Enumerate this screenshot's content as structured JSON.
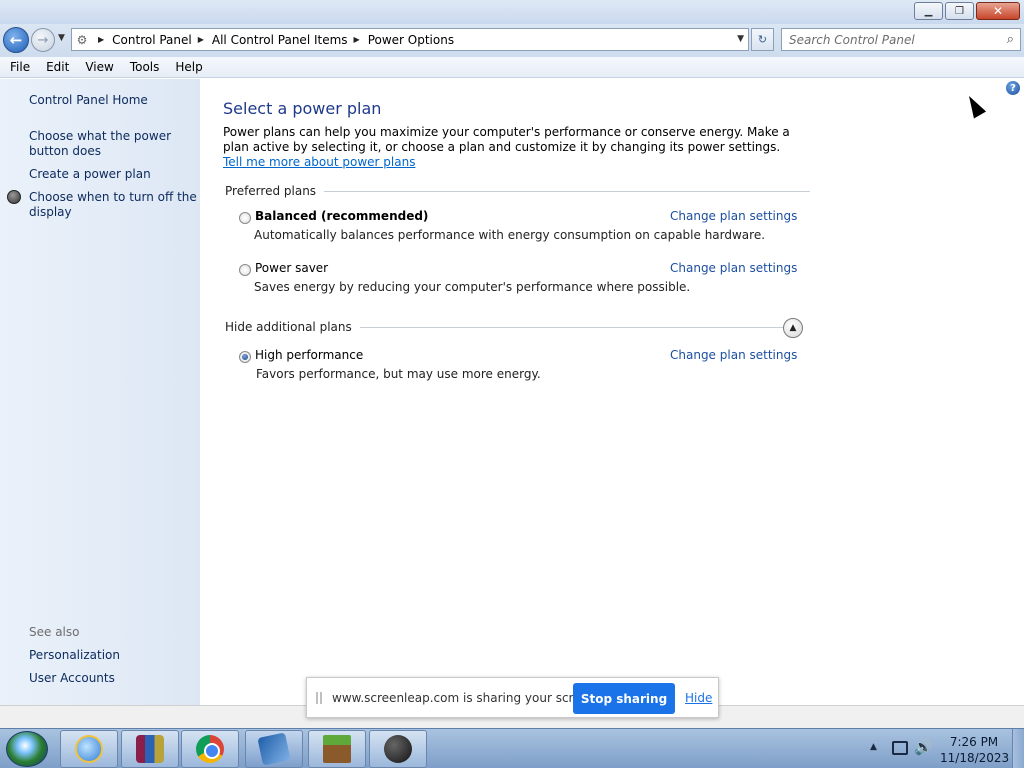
{
  "address": {
    "crumbs": [
      "Control Panel",
      "All Control Panel Items",
      "Power Options"
    ],
    "search_placeholder": "Search Control Panel"
  },
  "menu": [
    "File",
    "Edit",
    "View",
    "Tools",
    "Help"
  ],
  "sidebar": {
    "home": "Control Panel Home",
    "items": [
      "Choose what the power button does",
      "Create a power plan",
      "Choose when to turn off the display"
    ],
    "see_also_label": "See also",
    "see_also": [
      "Personalization",
      "User Accounts"
    ]
  },
  "main": {
    "title": "Select a power plan",
    "intro": "Power plans can help you maximize your computer's performance or conserve energy. Make a plan active by selecting it, or choose a plan and customize it by changing its power settings.",
    "intro_link": "Tell me more about power plans",
    "preferred_label": "Preferred plans",
    "hide_label": "Hide additional plans",
    "change_link": "Change plan settings",
    "plans": [
      {
        "name": "Balanced (recommended)",
        "desc": "Automatically balances performance with energy consumption on capable hardware.",
        "selected": false
      },
      {
        "name": "Power saver",
        "desc": "Saves energy by reducing your computer's performance where possible.",
        "selected": false
      },
      {
        "name": "High performance",
        "desc": "Favors performance, but may use more energy.",
        "selected": true
      }
    ]
  },
  "share": {
    "message": "www.screenleap.com is sharing your screen.",
    "stop": "Stop sharing",
    "hide": "Hide"
  },
  "clock": {
    "time": "7:26 PM",
    "date": "11/18/2023"
  }
}
